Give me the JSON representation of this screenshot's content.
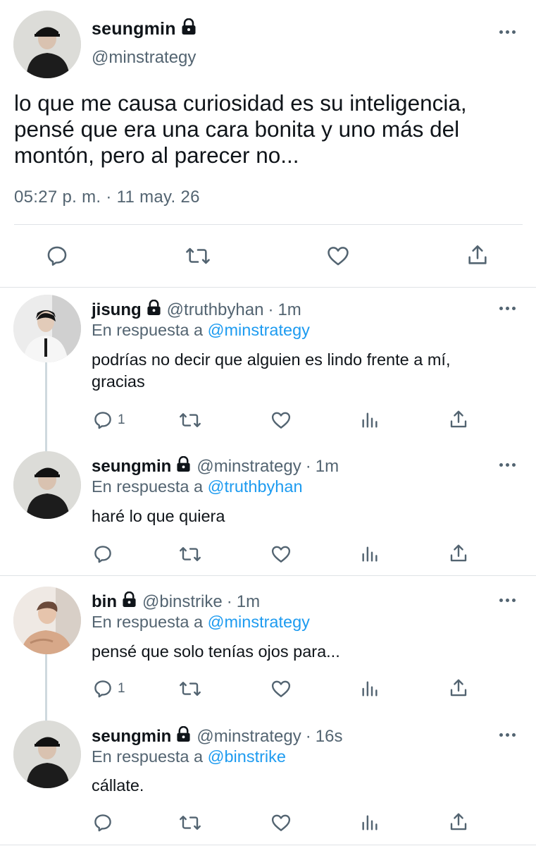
{
  "main_tweet": {
    "name": "seungmin",
    "handle": "@minstrategy",
    "text_lines": [
      "lo que me causa curiosidad es su inteligencia,",
      "pensé que era una cara bonita y uno más del",
      "montón, pero al parecer no..."
    ],
    "time": "05:27 p. m.",
    "separator": "·",
    "date": "11 may. 26"
  },
  "replies": [
    {
      "name": "jisung",
      "handle": "@truthbyhan",
      "time": "1m",
      "replying_prefix": "En respuesta a",
      "replying_to": "@minstrategy",
      "body_lines": [
        "podrías no decir que alguien es lindo frente a mí,",
        "gracias"
      ],
      "reply_count": "1"
    },
    {
      "name": "seungmin",
      "handle": "@minstrategy",
      "time": "1m",
      "replying_prefix": "En respuesta a",
      "replying_to": "@truthbyhan",
      "body_lines": [
        "haré lo que quiera"
      ],
      "reply_count": ""
    },
    {
      "name": "bin",
      "handle": "@binstrike",
      "time": "1m",
      "replying_prefix": "En respuesta a",
      "replying_to": "@minstrategy",
      "body_lines": [
        "pensé que solo tenías ojos para..."
      ],
      "reply_count": "1"
    },
    {
      "name": "seungmin",
      "handle": "@minstrategy",
      "time": "16s",
      "replying_prefix": "En respuesta a",
      "replying_to": "@binstrike",
      "body_lines": [
        "cállate."
      ],
      "reply_count": ""
    }
  ],
  "separator": "·",
  "icons": {
    "reply": "reply-icon",
    "retweet": "retweet-icon",
    "like": "heart-icon",
    "views": "views-icon",
    "share": "share-icon",
    "more": "more-icon",
    "lock": "lock-icon"
  },
  "colors": {
    "text": "#0f1419",
    "secondary": "#536471",
    "link": "#1d9bf0",
    "divider": "#dfe3e6"
  }
}
